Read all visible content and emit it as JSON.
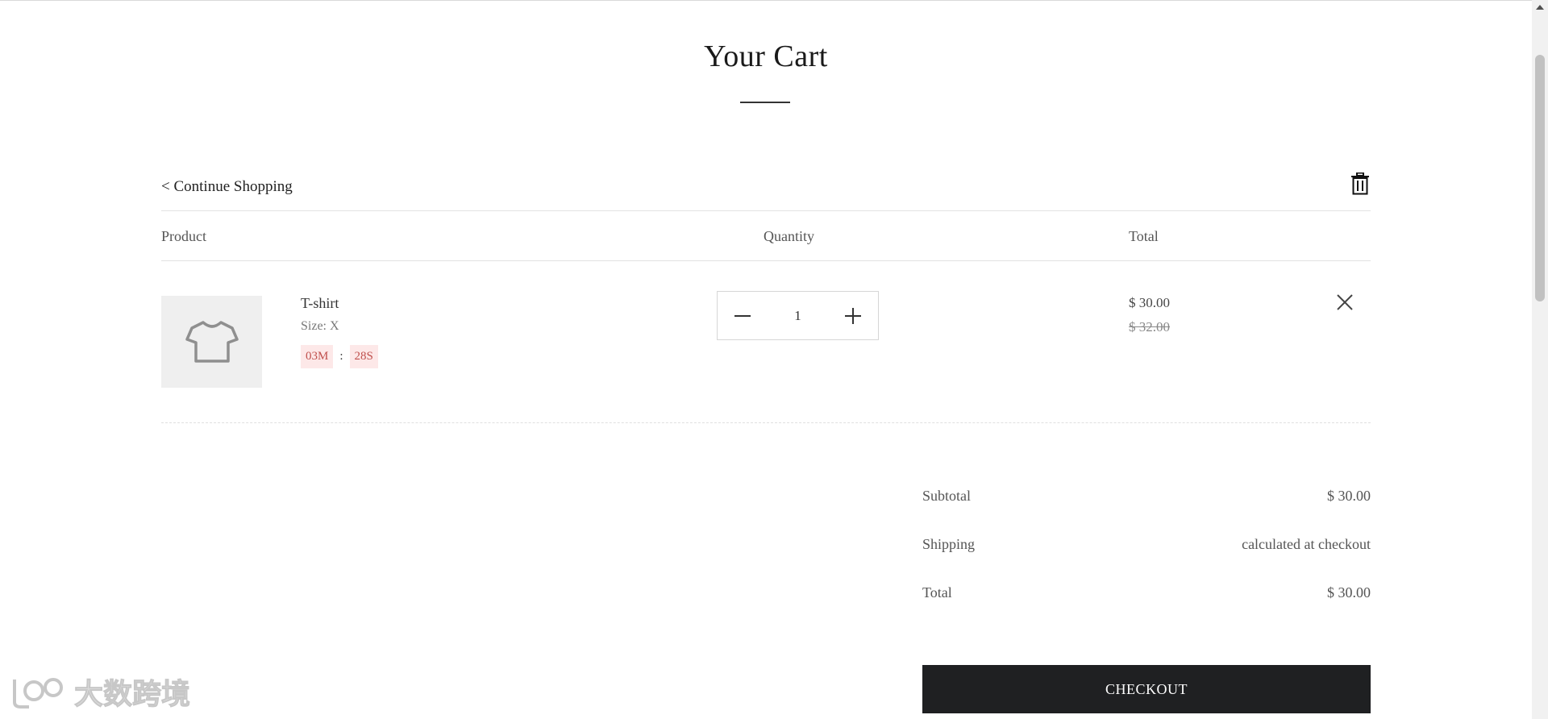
{
  "page": {
    "title": "Your Cart"
  },
  "nav": {
    "continue_label": "< Continue Shopping"
  },
  "table": {
    "headers": {
      "product": "Product",
      "quantity": "Quantity",
      "total": "Total"
    }
  },
  "items": [
    {
      "name": "T-shirt",
      "size": "Size: X",
      "timer": {
        "minutes": "03M",
        "separator": ":",
        "seconds": "28S"
      },
      "quantity": "1",
      "price": "$ 30.00",
      "original_price": "$ 32.00"
    }
  ],
  "summary": {
    "subtotal_label": "Subtotal",
    "subtotal_value": "$ 30.00",
    "shipping_label": "Shipping",
    "shipping_value": "calculated at checkout",
    "total_label": "Total",
    "total_value": "$ 30.00"
  },
  "checkout": {
    "label": "CHECKOUT"
  },
  "watermark": {
    "text": "大数跨境"
  },
  "icons": {
    "trash": "trash-icon",
    "minus": "minus-icon",
    "plus": "plus-icon",
    "close": "close-icon",
    "tshirt": "tshirt-icon"
  },
  "colors": {
    "timer_bg": "#fde8e8",
    "timer_text": "#c0504d",
    "checkout_bg": "#1f2022"
  }
}
